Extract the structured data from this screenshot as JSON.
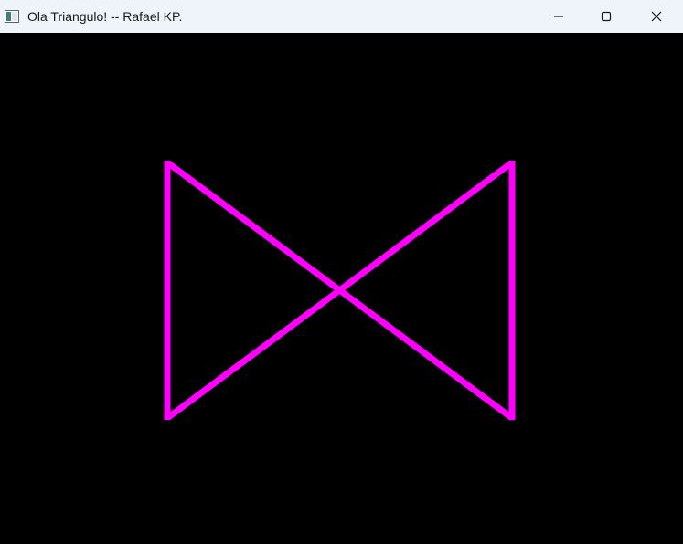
{
  "window": {
    "title": "Ola Triangulo! -- Rafael KP.",
    "icon": "application-window-icon",
    "controls": {
      "minimize_icon": "minimize-icon",
      "maximize_icon": "maximize-icon",
      "close_icon": "close-icon"
    }
  },
  "canvas": {
    "background_color": "#000000",
    "shape": {
      "type": "bowtie-outline",
      "description_tag": "two-triangles",
      "stroke_color": "#ff00ff"
    }
  }
}
